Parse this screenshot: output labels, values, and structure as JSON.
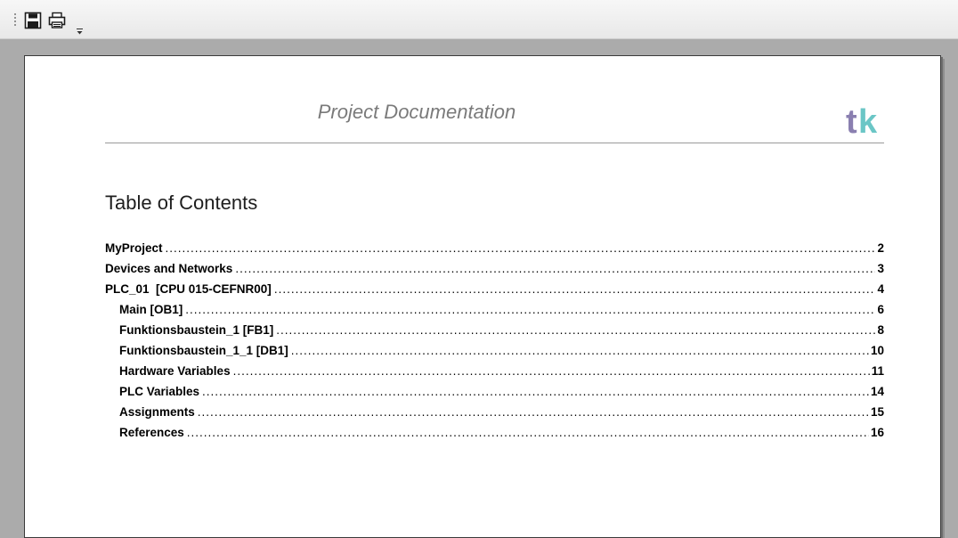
{
  "toolbar": {
    "save_icon": "save-icon",
    "print_icon": "print-icon",
    "overflow_icon": "chevron-down-icon"
  },
  "document": {
    "header_title": "Project Documentation",
    "logo": {
      "text": "tk",
      "colors": {
        "t": "#8a7fb0",
        "k": "#5cc0c0"
      }
    },
    "toc_heading": "Table of Contents",
    "toc": [
      {
        "title": "MyProject",
        "page": "2",
        "level": 0
      },
      {
        "title": "Devices and Networks",
        "page": "3",
        "level": 0
      },
      {
        "title": "PLC_01  [CPU 015-CEFNR00]",
        "page": "4",
        "level": 0
      },
      {
        "title": "Main [OB1]",
        "page": "6",
        "level": 1
      },
      {
        "title": "Funktionsbaustein_1 [FB1]",
        "page": "8",
        "level": 1
      },
      {
        "title": "Funktionsbaustein_1_1 [DB1]",
        "page": "10",
        "level": 1
      },
      {
        "title": "Hardware Variables",
        "page": "11",
        "level": 1
      },
      {
        "title": "PLC Variables",
        "page": "14",
        "level": 1
      },
      {
        "title": "Assignments",
        "page": "15",
        "level": 1
      },
      {
        "title": "References",
        "page": "16",
        "level": 1
      }
    ]
  }
}
